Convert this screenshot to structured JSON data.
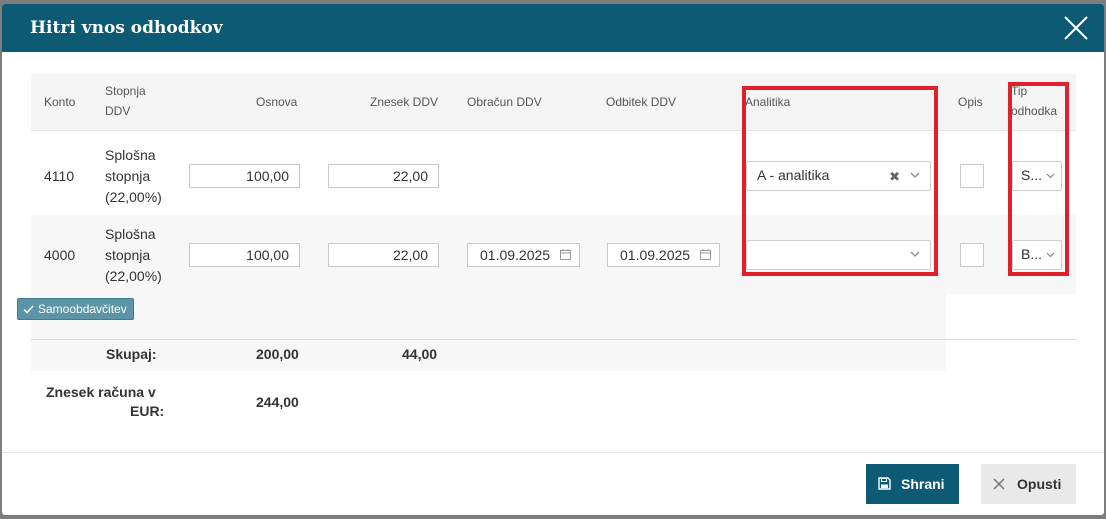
{
  "dialog": {
    "title": "Hitri vnos odhodkov"
  },
  "columns": {
    "konto": "Konto",
    "stopnja_1": "Stopnja",
    "stopnja_2": "DDV",
    "osnova": "Osnova",
    "znesek_ddv": "Znesek DDV",
    "obracun_ddv": "Obračun DDV",
    "odbitek_ddv": "Odbitek DDV",
    "analitika": "Analitika",
    "opis": "Opis",
    "tip_1": "Tip",
    "tip_2": "odhodka"
  },
  "rows": [
    {
      "konto": "4110",
      "stopnja_1": "Splošna",
      "stopnja_2": "stopnja",
      "stopnja_3": "(22,00%)",
      "osnova": "100,00",
      "znesek_ddv": "22,00",
      "analitika": "A - analitika",
      "tip": "S..."
    },
    {
      "konto": "4000",
      "stopnja_1": "Splošna",
      "stopnja_2": "stopnja",
      "stopnja_3": "(22,00%)",
      "osnova": "100,00",
      "znesek_ddv": "22,00",
      "obracun_ddv": "01.09.2025",
      "odbitek_ddv": "01.09.2025",
      "analitika": "",
      "tip": "B..."
    }
  ],
  "tag": {
    "label": "Samoobdavčitev"
  },
  "totals": {
    "skupaj_label": "Skupaj:",
    "skupaj_osnova": "200,00",
    "skupaj_ddv": "44,00",
    "znesek_label_1": "Znesek računa v",
    "znesek_label_2": "EUR:",
    "znesek_value": "244,00"
  },
  "buttons": {
    "save": "Shrani",
    "cancel": "Opusti"
  },
  "colors": {
    "header": "#0d5a75",
    "highlight": "#e0202a",
    "tag": "#5b95a6"
  }
}
